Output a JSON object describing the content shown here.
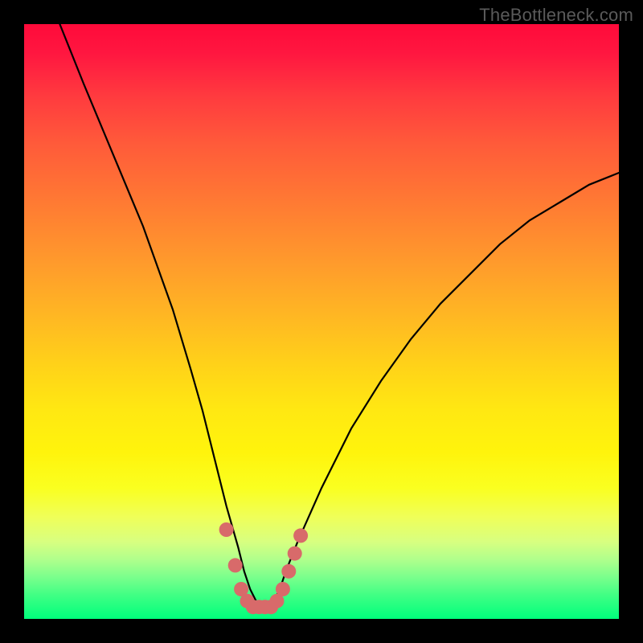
{
  "watermark": "TheBottleneck.com",
  "chart_data": {
    "type": "line",
    "title": "",
    "xlabel": "",
    "ylabel": "",
    "xlim": [
      0,
      100
    ],
    "ylim": [
      0,
      100
    ],
    "series": [
      {
        "name": "bottleneck-curve",
        "x": [
          6,
          10,
          15,
          20,
          25,
          28,
          30,
          32,
          34,
          36,
          37,
          38,
          39,
          40,
          41,
          42,
          43,
          44,
          46,
          50,
          55,
          60,
          65,
          70,
          75,
          80,
          85,
          90,
          95,
          100
        ],
        "y": [
          100,
          90,
          78,
          66,
          52,
          42,
          35,
          27,
          19,
          12,
          8,
          5,
          3,
          2,
          2,
          3,
          5,
          8,
          13,
          22,
          32,
          40,
          47,
          53,
          58,
          63,
          67,
          70,
          73,
          75
        ]
      }
    ],
    "markers": {
      "name": "highlight-dots",
      "color": "#d86a6a",
      "points": [
        {
          "x": 34.0,
          "y": 15
        },
        {
          "x": 35.5,
          "y": 9
        },
        {
          "x": 36.5,
          "y": 5
        },
        {
          "x": 37.5,
          "y": 3
        },
        {
          "x": 38.5,
          "y": 2
        },
        {
          "x": 39.5,
          "y": 2
        },
        {
          "x": 40.5,
          "y": 2
        },
        {
          "x": 41.5,
          "y": 2
        },
        {
          "x": 42.5,
          "y": 3
        },
        {
          "x": 43.5,
          "y": 5
        },
        {
          "x": 44.5,
          "y": 8
        },
        {
          "x": 45.5,
          "y": 11
        },
        {
          "x": 46.5,
          "y": 14
        }
      ]
    },
    "gradient_stops": [
      {
        "pos": 0,
        "color": "#ff0a3a"
      },
      {
        "pos": 50,
        "color": "#ffd418"
      },
      {
        "pos": 100,
        "color": "#00ff7c"
      }
    ]
  }
}
